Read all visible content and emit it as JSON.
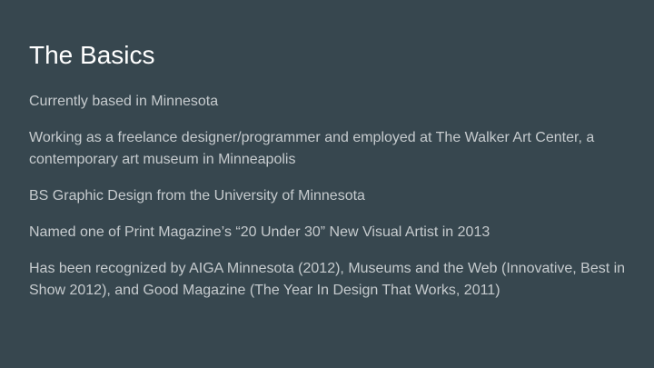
{
  "slide": {
    "title": "The Basics",
    "items": [
      "Currently based in Minnesota",
      "Working as a freelance designer/programmer and employed at The Walker Art Center, a contemporary art museum in Minneapolis",
      "BS Graphic Design from the University of Minnesota",
      "Named one of Print Magazine’s “20 Under 30” New Visual Artist in 2013",
      "Has been recognized by AIGA Minnesota (2012), Museums and the Web (Innovative, Best in Show 2012), and Good Magazine (The Year In Design That Works, 2011)"
    ]
  },
  "colors": {
    "background": "#37474f",
    "title": "#ffffff",
    "body_text": "#c6cbce"
  }
}
